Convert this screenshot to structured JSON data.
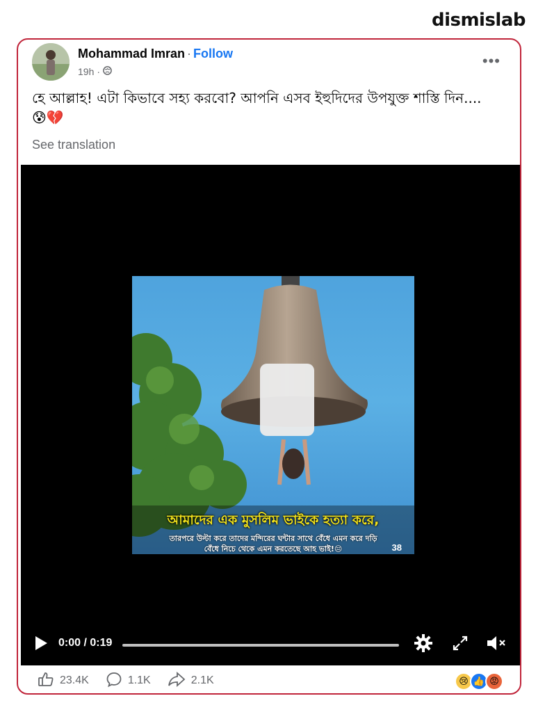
{
  "brand": {
    "logo_text": "dismislab"
  },
  "post": {
    "author": "Mohammad Imran",
    "separator": "·",
    "follow_label": "Follow",
    "timestamp": "19h",
    "text": "হে আল্লাহ! এটা কিভাবে সহ্য করবো? আপনি এসব ইহুদিদের উপযুক্ত শাস্তি দিন....",
    "emojis": "😰💔",
    "see_translation": "See translation",
    "more_icon": "more-options-icon"
  },
  "video": {
    "caption_line1": "আমাদের এক মুসলিম ভাইকে হত্যা করে,",
    "caption_line2": "তারপরে উল্টা করে তাদের মন্দিরের ঘন্টার সাথে বেঁধে এমন করে দড়ি",
    "caption_line3": "বেঁধে নিচে থেকে এমন করতেছে আহ ভাই!😔",
    "frame_counter": "38",
    "time_display": "0:00 / 0:19",
    "progress": 0.0
  },
  "footer": {
    "likes": "23.4K",
    "comments": "1.1K",
    "shares": "2.1K"
  },
  "colors": {
    "accent": "#1877f2",
    "border": "#c0243a",
    "muted": "#65676b"
  }
}
